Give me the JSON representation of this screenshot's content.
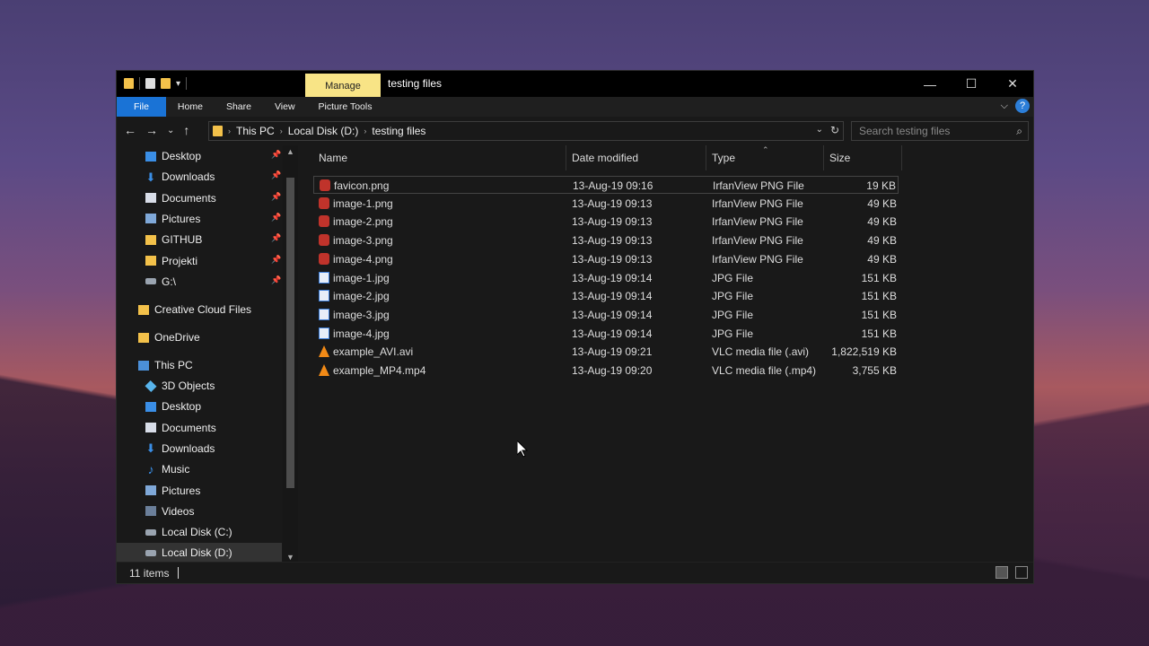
{
  "titlebar": {
    "manage_tab": "Manage",
    "title": "testing files",
    "minimize": "—",
    "maximize": "☐",
    "close": "✕"
  },
  "ribbon": {
    "tabs": [
      "File",
      "Home",
      "Share",
      "View",
      "Picture Tools"
    ],
    "help": "?"
  },
  "address": {
    "crumbs": [
      "This PC",
      "Local Disk (D:)",
      "testing files"
    ],
    "search_placeholder": "Search testing files"
  },
  "navpane": {
    "quick": [
      {
        "label": "Desktop",
        "icon": "desktop-icon",
        "pinned": true
      },
      {
        "label": "Downloads",
        "icon": "downloads-icon",
        "pinned": true
      },
      {
        "label": "Documents",
        "icon": "documents-icon",
        "pinned": true
      },
      {
        "label": "Pictures",
        "icon": "pictures-icon",
        "pinned": true
      },
      {
        "label": "GITHUB",
        "icon": "folder-icon",
        "pinned": true
      },
      {
        "label": "Projekti",
        "icon": "folder-icon",
        "pinned": true
      },
      {
        "label": "G:\\",
        "icon": "drive-icon",
        "pinned": true
      }
    ],
    "creative_cloud": "Creative Cloud Files",
    "onedrive": "OneDrive",
    "this_pc": "This PC",
    "pc_items": [
      {
        "label": "3D Objects",
        "icon": "3d-objects-icon"
      },
      {
        "label": "Desktop",
        "icon": "desktop-icon"
      },
      {
        "label": "Documents",
        "icon": "documents-icon"
      },
      {
        "label": "Downloads",
        "icon": "downloads-icon"
      },
      {
        "label": "Music",
        "icon": "music-icon"
      },
      {
        "label": "Pictures",
        "icon": "pictures-icon"
      },
      {
        "label": "Videos",
        "icon": "videos-icon"
      },
      {
        "label": "Local Disk (C:)",
        "icon": "drive-icon"
      },
      {
        "label": "Local Disk (D:)",
        "icon": "drive-icon",
        "selected": true
      }
    ]
  },
  "columns": {
    "name": "Name",
    "date": "Date modified",
    "type": "Type",
    "size": "Size"
  },
  "files": [
    {
      "name": "favicon.png",
      "date": "13-Aug-19 09:16",
      "type": "IrfanView PNG File",
      "size": "19 KB",
      "kind": "png"
    },
    {
      "name": "image-1.png",
      "date": "13-Aug-19 09:13",
      "type": "IrfanView PNG File",
      "size": "49 KB",
      "kind": "png"
    },
    {
      "name": "image-2.png",
      "date": "13-Aug-19 09:13",
      "type": "IrfanView PNG File",
      "size": "49 KB",
      "kind": "png"
    },
    {
      "name": "image-3.png",
      "date": "13-Aug-19 09:13",
      "type": "IrfanView PNG File",
      "size": "49 KB",
      "kind": "png"
    },
    {
      "name": "image-4.png",
      "date": "13-Aug-19 09:13",
      "type": "IrfanView PNG File",
      "size": "49 KB",
      "kind": "png"
    },
    {
      "name": "image-1.jpg",
      "date": "13-Aug-19 09:14",
      "type": "JPG File",
      "size": "151 KB",
      "kind": "jpg"
    },
    {
      "name": "image-2.jpg",
      "date": "13-Aug-19 09:14",
      "type": "JPG File",
      "size": "151 KB",
      "kind": "jpg"
    },
    {
      "name": "image-3.jpg",
      "date": "13-Aug-19 09:14",
      "type": "JPG File",
      "size": "151 KB",
      "kind": "jpg"
    },
    {
      "name": "image-4.jpg",
      "date": "13-Aug-19 09:14",
      "type": "JPG File",
      "size": "151 KB",
      "kind": "jpg"
    },
    {
      "name": "example_AVI.avi",
      "date": "13-Aug-19 09:21",
      "type": "VLC media file (.avi)",
      "size": "1,822,519 KB",
      "kind": "vlc"
    },
    {
      "name": "example_MP4.mp4",
      "date": "13-Aug-19 09:20",
      "type": "VLC media file (.mp4)",
      "size": "3,755 KB",
      "kind": "vlc"
    }
  ],
  "status": {
    "count": "11 items"
  }
}
